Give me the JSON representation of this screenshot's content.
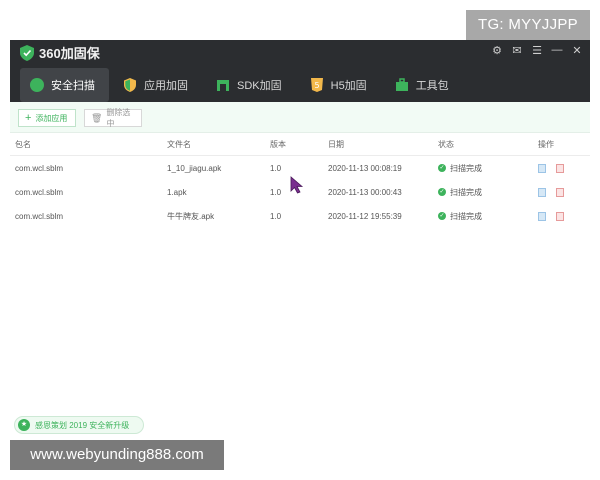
{
  "watermark_top": "TG: MYYJJPP",
  "watermark_bottom": "www.webyunding888.com",
  "app": {
    "title": "360加固保"
  },
  "nav": {
    "tabs": [
      {
        "label": "安全扫描",
        "icon": "scan-icon",
        "active": true
      },
      {
        "label": "应用加固",
        "icon": "shield-icon",
        "active": false
      },
      {
        "label": "SDK加固",
        "icon": "sdk-icon",
        "active": false
      },
      {
        "label": "H5加固",
        "icon": "h5-icon",
        "active": false
      },
      {
        "label": "工具包",
        "icon": "toolbox-icon",
        "active": false
      }
    ]
  },
  "toolbar": {
    "add_label": "添加应用",
    "delete_label": "删除选中"
  },
  "table": {
    "headers": [
      "包名",
      "文件名",
      "版本",
      "日期",
      "状态",
      "操作"
    ],
    "rows": [
      {
        "package": "com.wcl.sblm",
        "file": "1_10_jiagu.apk",
        "version": "1.0",
        "date": "2020-11-13 00:08:19",
        "status": "扫描完成"
      },
      {
        "package": "com.wcl.sblm",
        "file": "1.apk",
        "version": "1.0",
        "date": "2020-11-13 00:00:43",
        "status": "扫描完成"
      },
      {
        "package": "com.wcl.sblm",
        "file": "牛牛牌友.apk",
        "version": "1.0",
        "date": "2020-11-12 19:55:39",
        "status": "扫描完成"
      }
    ]
  },
  "footer": {
    "upgrade_text": "感恩策划 2019 安全新升级"
  },
  "colors": {
    "accent": "#3db35c",
    "titlebar": "#2b2d30"
  }
}
